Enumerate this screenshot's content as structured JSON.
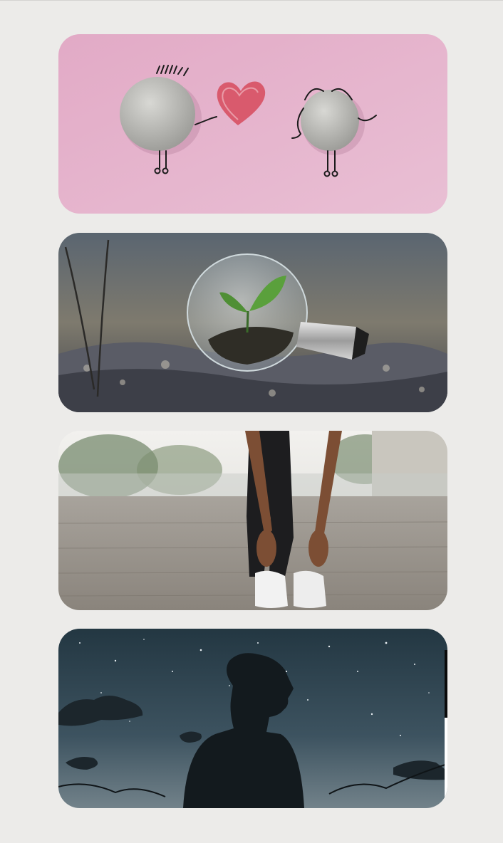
{
  "gallery": {
    "images": [
      {
        "icon": "pebble-couple-heart-image"
      },
      {
        "icon": "plant-in-lightbulb-image"
      },
      {
        "icon": "person-stretching-image"
      },
      {
        "icon": "silhouette-under-stars-image"
      }
    ]
  },
  "colors": {
    "background": "#ecebe9",
    "card1_bg": "#e4afc9",
    "card4_sky": "#3d5360"
  }
}
